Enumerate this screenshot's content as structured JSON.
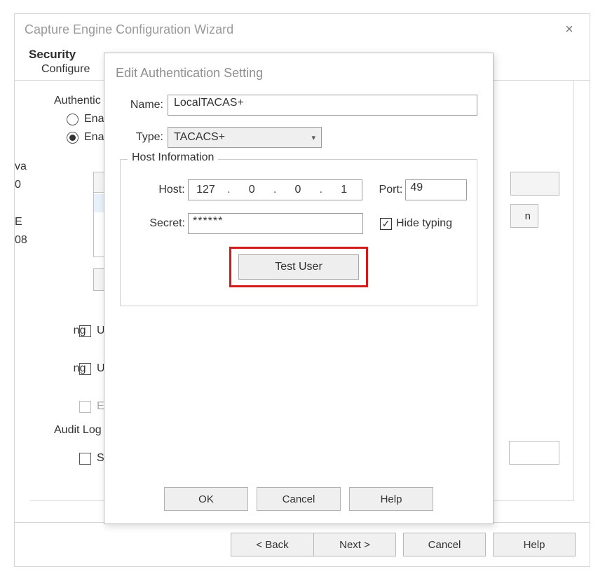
{
  "wizard": {
    "title": "Capture Engine Configuration Wizard",
    "section_title": "Security",
    "section_sub": "Configure",
    "auth_label": "Authentic",
    "radio1": "Ena",
    "radio2": "Ena",
    "left_va": "va",
    "left_0": "0",
    "left_E": "E",
    "left_08": "08",
    "sidebtn_blank": "",
    "sidebtn_n": "n",
    "tail_ng1": "ng",
    "tail_ng2": "ng",
    "upd1": "Upc",
    "upd2": "Upc",
    "ena3": "Ena",
    "audit_label": "Audit Log",
    "audit_chk": "Ser",
    "footer_back": "< Back",
    "footer_next": "Next >",
    "footer_cancel": "Cancel",
    "footer_help": "Help"
  },
  "dialog": {
    "title": "Edit Authentication Setting",
    "name_label": "Name:",
    "name_value": "LocalTACAS+",
    "type_label": "Type:",
    "type_value": "TACACS+",
    "hostinfo_legend": "Host Information",
    "host_label": "Host:",
    "ip": {
      "o1": "127",
      "o2": "0",
      "o3": "0",
      "o4": "1"
    },
    "port_label": "Port:",
    "port_value": "49",
    "secret_label": "Secret:",
    "secret_value": "******",
    "hide_label": "Hide typing",
    "test_label": "Test User",
    "ok": "OK",
    "cancel": "Cancel",
    "help": "Help"
  }
}
